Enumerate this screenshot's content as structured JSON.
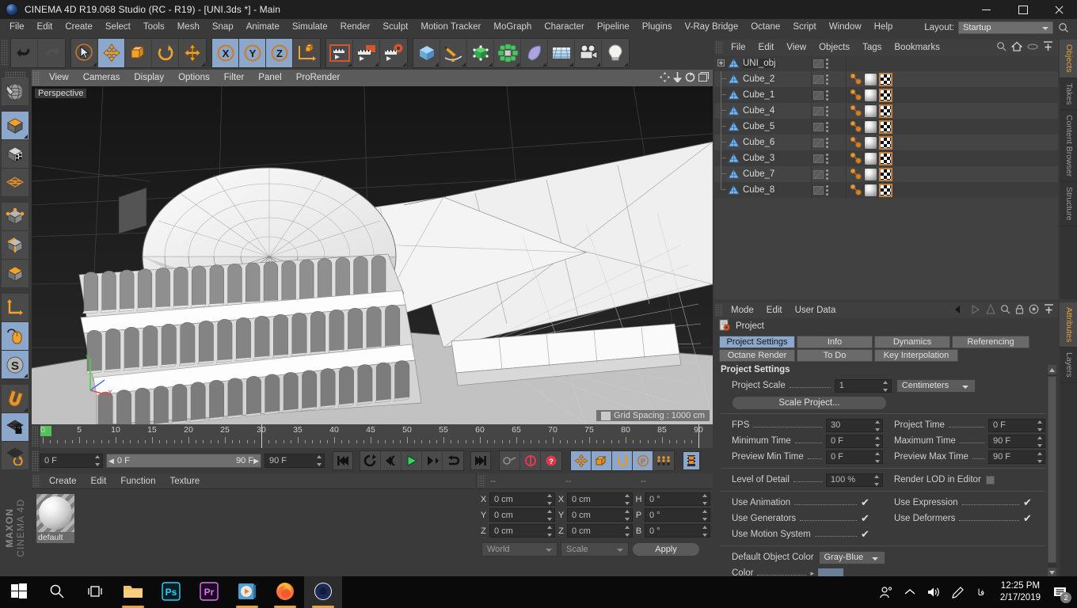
{
  "window": {
    "title": "CINEMA 4D R19.068 Studio (RC - R19) - [UNI.3ds *] - Main",
    "minimize": "minimize-icon",
    "maximize": "maximize-icon",
    "close": "close-icon"
  },
  "menubar": {
    "items": [
      "File",
      "Edit",
      "Create",
      "Select",
      "Tools",
      "Mesh",
      "Snap",
      "Animate",
      "Simulate",
      "Render",
      "Sculpt",
      "Motion Tracker",
      "MoGraph",
      "Character",
      "Pipeline",
      "Plugins",
      "V-Ray Bridge",
      "Octane",
      "Script",
      "Window",
      "Help"
    ],
    "layout_label": "Layout:",
    "layout_value": "Startup"
  },
  "toolbar": {
    "groups": [
      {
        "name": "undo-redo",
        "buttons": [
          {
            "name": "undo-button",
            "icon": "undo-icon",
            "active": false
          },
          {
            "name": "redo-button",
            "icon": "redo-icon",
            "active": false,
            "disabled": true
          }
        ]
      },
      {
        "name": "transform",
        "buttons": [
          {
            "name": "live-selection-button",
            "icon": "cursor-select-icon",
            "active": false
          },
          {
            "name": "move-button",
            "icon": "move-icon",
            "active": true
          },
          {
            "name": "scale-button",
            "icon": "scale-icon",
            "active": false
          },
          {
            "name": "rotate-button",
            "icon": "rotate-icon",
            "active": false
          },
          {
            "name": "magnet-move-button",
            "icon": "move-icon",
            "active": false
          }
        ]
      },
      {
        "name": "axis-locks",
        "buttons": [
          {
            "name": "lock-x-button",
            "icon": "x-axis-icon",
            "active": true
          },
          {
            "name": "lock-y-button",
            "icon": "y-axis-icon",
            "active": true
          },
          {
            "name": "lock-z-button",
            "icon": "z-axis-icon",
            "active": true
          },
          {
            "name": "world-object-axis-button",
            "icon": "world-axis-icon",
            "active": false
          }
        ]
      },
      {
        "name": "render",
        "buttons": [
          {
            "name": "render-view-button",
            "icon": "render-view-icon",
            "active": false
          },
          {
            "name": "render-to-picture-viewer-button",
            "icon": "render-picture-icon",
            "active": false
          },
          {
            "name": "render-settings-button",
            "icon": "render-settings-icon",
            "active": false
          }
        ]
      },
      {
        "name": "create",
        "buttons": [
          {
            "name": "add-cube-button",
            "icon": "cube-icon",
            "active": false
          },
          {
            "name": "add-spline-button",
            "icon": "pen-spline-icon",
            "active": false
          },
          {
            "name": "add-nurbs-button",
            "icon": "nurbs-icon",
            "active": false
          },
          {
            "name": "add-array-button",
            "icon": "array-icon",
            "active": false
          },
          {
            "name": "add-deformer-button",
            "icon": "deformer-icon",
            "active": false
          },
          {
            "name": "add-environment-button",
            "icon": "environment-icon",
            "active": false
          },
          {
            "name": "add-camera-button",
            "icon": "camera-icon",
            "active": false
          },
          {
            "name": "add-light-button",
            "icon": "light-bulb-icon",
            "active": false
          }
        ]
      }
    ]
  },
  "left_toolbar": {
    "buttons": [
      {
        "name": "make-editable-button",
        "icon": "globe-wire-icon",
        "active": false
      },
      {
        "name": "model-mode-button",
        "icon": "model-cube-icon",
        "active": true
      },
      {
        "name": "texture-mode-button",
        "icon": "texture-cube-icon",
        "active": false
      },
      {
        "name": "workplane-mode-button",
        "icon": "workplane-grid-icon",
        "active": false
      },
      {
        "name": "points-mode-button",
        "icon": "points-cube-icon",
        "active": false
      },
      {
        "name": "edges-mode-button",
        "icon": "edges-cube-icon",
        "active": false
      },
      {
        "name": "polygons-mode-button",
        "icon": "polygons-cube-icon",
        "active": false
      },
      {
        "name": "object-axis-mode-button",
        "icon": "axis-L-icon",
        "active": false
      },
      {
        "name": "viewport-solo-button",
        "icon": "mouse-icon",
        "active": true
      },
      {
        "name": "snap-enable-button",
        "icon": "snap-s-icon",
        "active": true
      },
      {
        "name": "magnet-tool-button",
        "icon": "magnet-icon",
        "active": false
      },
      {
        "name": "workplane-lock-button",
        "icon": "grid-lock-icon",
        "active": true
      },
      {
        "name": "workplane-rotate-button",
        "icon": "grid-rotate-icon",
        "active": false
      }
    ],
    "brand_bold": "MAXON",
    "brand_thin": "CINEMA 4D"
  },
  "viewport": {
    "menus": [
      "View",
      "Cameras",
      "Display",
      "Options",
      "Filter",
      "Panel",
      "ProRender"
    ],
    "nav_icons": [
      "pan-icon",
      "zoom-icon",
      "rotate-icon",
      "maximize-viewport-icon"
    ],
    "label": "Perspective",
    "grid_info": "Grid Spacing : 1000 cm",
    "axis_labels": {
      "y": "Y",
      "x": "X",
      "z": "Z"
    }
  },
  "timeline": {
    "ticks": [
      0,
      5,
      10,
      15,
      20,
      25,
      30,
      35,
      40,
      45,
      50,
      55,
      60,
      65,
      70,
      75,
      80,
      85,
      90
    ],
    "current_frame_field": "0 F",
    "range_start": "0 F",
    "range_end": "90 F",
    "end_frame_field": "90 F",
    "frame_field_right": "0 F",
    "transport": [
      {
        "name": "go-to-start-button",
        "icon": "skip-start-icon"
      },
      {
        "name": "play-reverse-loop-button",
        "icon": "loop-icon"
      },
      {
        "name": "step-back-button",
        "icon": "step-back-icon"
      },
      {
        "name": "play-button",
        "icon": "play-icon"
      },
      {
        "name": "step-forward-button",
        "icon": "step-forward-icon"
      },
      {
        "name": "loop-playback-button",
        "icon": "return-loop-icon"
      },
      {
        "name": "go-to-end-button",
        "icon": "skip-end-icon"
      }
    ],
    "keyframe_buttons": [
      {
        "name": "record-active-objects-button",
        "icon": "key-icon",
        "active": false
      },
      {
        "name": "autokeying-button",
        "icon": "autokey-icon",
        "active": false
      },
      {
        "name": "keyframe-selection-button",
        "icon": "key-question-icon",
        "active": false
      }
    ],
    "key_filter_buttons": [
      {
        "name": "key-position-button",
        "icon": "move-icon",
        "active": true
      },
      {
        "name": "key-scale-button",
        "icon": "scale-icon",
        "active": true
      },
      {
        "name": "key-rotation-button",
        "icon": "rotate-icon",
        "active": true
      },
      {
        "name": "key-param-button",
        "icon": "param-p-icon",
        "active": true
      },
      {
        "name": "key-pla-button",
        "icon": "point-level-anim-icon",
        "active": false
      }
    ],
    "extra_button": {
      "name": "timeline-filmstrip-button",
      "icon": "filmstrip-icon",
      "active": true
    }
  },
  "material_manager": {
    "menus": [
      "Create",
      "Edit",
      "Function",
      "Texture"
    ],
    "materials": [
      {
        "name": "default"
      }
    ]
  },
  "coordinates": {
    "headers": [
      "--",
      "--",
      "--"
    ],
    "rows": [
      {
        "label_pos": "X",
        "pos": "0 cm",
        "label_size": "X",
        "size": "0 cm",
        "label_rot": "H",
        "rot": "0 °"
      },
      {
        "label_pos": "Y",
        "pos": "0 cm",
        "label_size": "Y",
        "size": "0 cm",
        "label_rot": "P",
        "rot": "0 °"
      },
      {
        "label_pos": "Z",
        "pos": "0 cm",
        "label_size": "Z",
        "size": "0 cm",
        "label_rot": "B",
        "rot": "0 °"
      }
    ],
    "coord_system": "World",
    "size_mode": "Scale",
    "apply_label": "Apply"
  },
  "object_manager": {
    "menus": [
      "File",
      "Edit",
      "View",
      "Objects",
      "Tags",
      "Bookmarks"
    ],
    "icons": [
      "search-icon",
      "home-icon",
      "link-icon",
      "add-layer-icon"
    ],
    "rows": [
      {
        "name": "UNI_obj",
        "depth": 0,
        "root": true,
        "selected": true,
        "tags": []
      },
      {
        "name": "Cube_2",
        "depth": 1,
        "root": false,
        "selected": false,
        "tags": [
          "phong",
          "material",
          "texture"
        ]
      },
      {
        "name": "Cube_1",
        "depth": 1,
        "root": false,
        "selected": false,
        "tags": [
          "phong",
          "material",
          "texture"
        ]
      },
      {
        "name": "Cube_4",
        "depth": 1,
        "root": false,
        "selected": false,
        "tags": [
          "phong",
          "material",
          "texture"
        ]
      },
      {
        "name": "Cube_5",
        "depth": 1,
        "root": false,
        "selected": false,
        "tags": [
          "phong",
          "material",
          "texture"
        ]
      },
      {
        "name": "Cube_6",
        "depth": 1,
        "root": false,
        "selected": false,
        "tags": [
          "phong",
          "material",
          "texture"
        ]
      },
      {
        "name": "Cube_3",
        "depth": 1,
        "root": false,
        "selected": false,
        "tags": [
          "phong",
          "material",
          "texture"
        ]
      },
      {
        "name": "Cube_7",
        "depth": 1,
        "root": false,
        "selected": false,
        "tags": [
          "phong",
          "material",
          "texture"
        ]
      },
      {
        "name": "Cube_8",
        "depth": 1,
        "root": false,
        "selected": false,
        "tags": [
          "phong",
          "material",
          "texture"
        ]
      }
    ]
  },
  "attribute_manager": {
    "menus": [
      "Mode",
      "Edit",
      "User Data"
    ],
    "icons": [
      "back-arrow-icon",
      "forward-arrow-icon",
      "up-arrow-icon",
      "search-icon",
      "lock-icon",
      "target-icon",
      "add-icon"
    ],
    "object_name": "Project",
    "object_icon": "project-settings-icon",
    "tabs_row1": [
      {
        "label": "Project Settings",
        "active": true
      },
      {
        "label": "Info",
        "active": false
      },
      {
        "label": "Dynamics",
        "active": false
      },
      {
        "label": "Referencing",
        "active": false
      }
    ],
    "tabs_row2": [
      {
        "label": "Octane Render",
        "active": false
      },
      {
        "label": "To Do",
        "active": false
      },
      {
        "label": "Key Interpolation",
        "active": false
      }
    ],
    "section_title": "Project Settings",
    "project_scale_label": "Project Scale",
    "project_scale_value": "1",
    "project_scale_unit": "Centimeters",
    "scale_project_button": "Scale Project...",
    "fields": [
      {
        "label": "FPS",
        "value": "30",
        "label2": "Project Time",
        "value2": "0 F"
      },
      {
        "label": "Minimum Time",
        "value": "0 F",
        "label2": "Maximum Time",
        "value2": "90 F"
      },
      {
        "label": "Preview Min Time",
        "value": "0 F",
        "label2": "Preview Max Time",
        "value2": "90 F"
      }
    ],
    "lod_label": "Level of Detail",
    "lod_value": "100 %",
    "render_lod_label": "Render LOD in Editor",
    "render_lod_checked": false,
    "checks": [
      {
        "label": "Use Animation",
        "checked": true,
        "label2": "Use Expression",
        "checked2": true
      },
      {
        "label": "Use Generators",
        "checked": true,
        "label2": "Use Deformers",
        "checked2": true
      },
      {
        "label": "Use Motion System",
        "checked": true,
        "label2": "",
        "checked2": null
      }
    ],
    "default_object_color_label": "Default Object Color",
    "default_object_color_value": "Gray-Blue",
    "color_label": "Color",
    "color_value": "#6d7f96"
  },
  "right_tabs_top": [
    {
      "label": "Objects",
      "active": true
    },
    {
      "label": "Takes",
      "active": false
    },
    {
      "label": "Content Browser",
      "active": false
    },
    {
      "label": "Structure",
      "active": false
    }
  ],
  "right_tabs_bottom": [
    {
      "label": "Attributes",
      "active": true
    },
    {
      "label": "Layers",
      "active": false
    }
  ],
  "taskbar": {
    "items": [
      {
        "name": "start-button",
        "icon": "windows-logo-icon",
        "open": false,
        "active": false
      },
      {
        "name": "search-button",
        "icon": "search-icon",
        "open": false,
        "active": false
      },
      {
        "name": "task-view-button",
        "icon": "task-view-icon",
        "open": false,
        "active": false
      },
      {
        "name": "file-explorer-button",
        "icon": "folder-icon",
        "open": true,
        "active": false
      },
      {
        "name": "photoshop-button",
        "icon": "photoshop-icon",
        "open": false,
        "active": false
      },
      {
        "name": "premiere-button",
        "icon": "premiere-icon",
        "open": false,
        "active": false
      },
      {
        "name": "media-player-button",
        "icon": "media-player-icon",
        "open": true,
        "active": false
      },
      {
        "name": "firefox-button",
        "icon": "firefox-icon",
        "open": true,
        "active": false
      },
      {
        "name": "cinema4d-button",
        "icon": "cinema4d-icon",
        "open": true,
        "active": true
      }
    ],
    "tray": [
      "people-icon",
      "show-hidden-icons-icon",
      "volume-icon",
      "pen-icon",
      "language-icon"
    ],
    "time": "12:25 PM",
    "date": "2/17/2019",
    "notification_count": "2"
  }
}
